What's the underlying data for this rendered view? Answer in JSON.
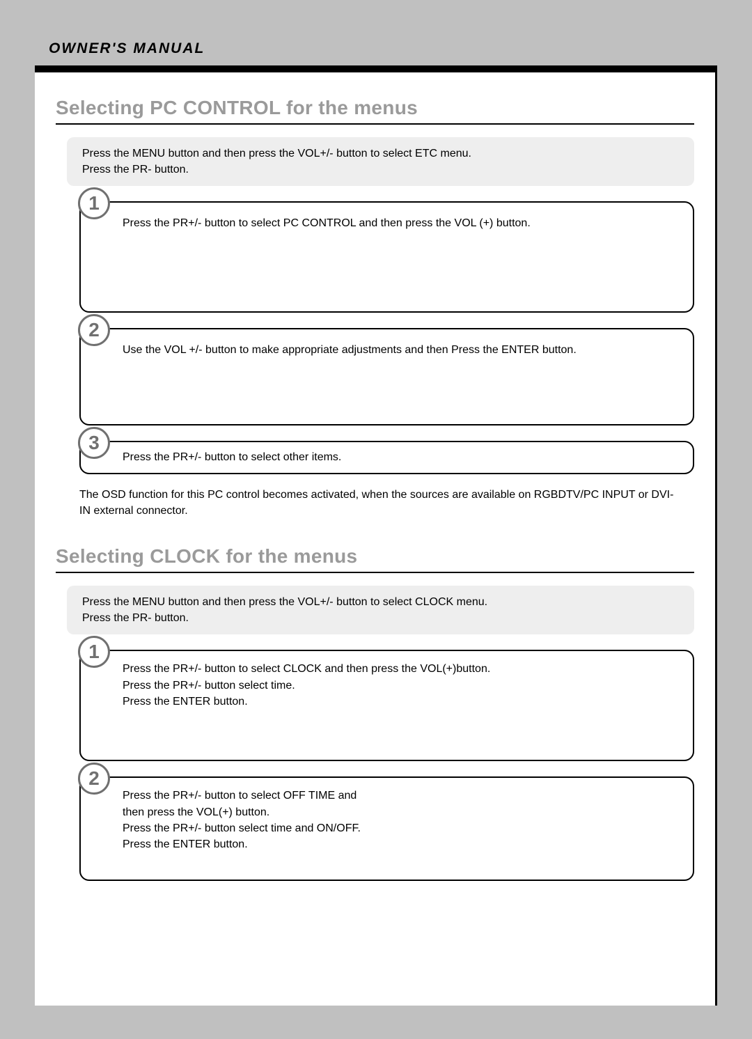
{
  "header": {
    "manual_label": "OWNER'S MANUAL"
  },
  "section1": {
    "title": "Selecting PC CONTROL for the menus",
    "intro_line1": "Press the MENU button and then press the VOL+/- button to select ETC menu.",
    "intro_line2": "Press the PR- button.",
    "steps": {
      "s1_num": "1",
      "s1_text": "Press the PR+/- button to select PC CONTROL and then press the VOL (+) button.",
      "s2_num": "2",
      "s2_text": "Use the VOL +/- button to make appropriate adjustments and then Press the ENTER button.",
      "s3_num": "3",
      "s3_text": "Press the PR+/- button to select other items."
    },
    "note": "The OSD function for this PC control becomes activated, when the sources are available on RGBDTV/PC INPUT or DVI-IN external connector."
  },
  "section2": {
    "title": "Selecting CLOCK for the menus",
    "intro_line1": "Press the MENU button and then press the VOL+/- button to select CLOCK menu.",
    "intro_line2": "Press the PR- button.",
    "steps": {
      "s1_num": "1",
      "s1_line1": "Press the PR+/- button to select CLOCK and then press the VOL(+)button.",
      "s1_line2": "Press the PR+/- button select time.",
      "s1_line3": "Press the ENTER button.",
      "s2_num": "2",
      "s2_line1": "Press the PR+/- button to select OFF TIME and",
      "s2_line2": "then press the VOL(+) button.",
      "s2_line3": "Press the PR+/- button select time and ON/OFF.",
      "s2_line4": "Press the ENTER button."
    }
  }
}
